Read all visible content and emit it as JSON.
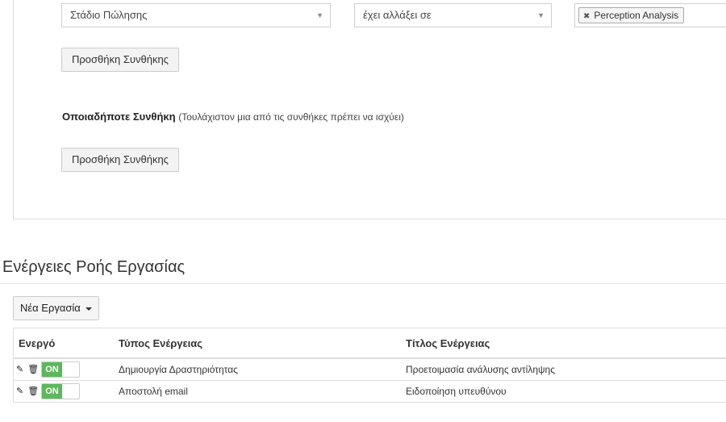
{
  "conditions": {
    "field_select": "Στάδιο Πώλησης",
    "operator_select": "έχει αλλάξει σε",
    "value_tags": [
      "Perception Analysis"
    ],
    "add_condition_label": "Προσθήκη Συνθήκης"
  },
  "any_condition": {
    "title": "Οποιαδήποτε Συνθήκη",
    "hint": "(Τουλάχιστον μια από τις συνθήκες πρέπει να ισχύει)",
    "add_condition_label": "Προσθήκη Συνθήκης"
  },
  "workflow_actions": {
    "title": "Ενέργειες Ροής Εργασίας",
    "new_task_label": "Νέα Εργασία",
    "columns": [
      "Ενεργό",
      "Τύπος Ενέργειας",
      "Τίτλος Ενέργειας"
    ],
    "rows": [
      {
        "active_label": "ON",
        "type": "Δημιουργία Δραστηριότητας",
        "title": "Προετοιμασία ανάλυσης αντίληψης"
      },
      {
        "active_label": "ON",
        "type": "Αποστολή email",
        "title": "Ειδοποίηση υπευθύνου"
      }
    ]
  },
  "icons": {
    "edit": "pencil-icon",
    "delete": "trash-icon",
    "dropdown": "chevron-down-icon",
    "remove_tag": "close-icon"
  },
  "colors": {
    "toggle_on": "#5cb85c",
    "border": "#dddddd"
  }
}
